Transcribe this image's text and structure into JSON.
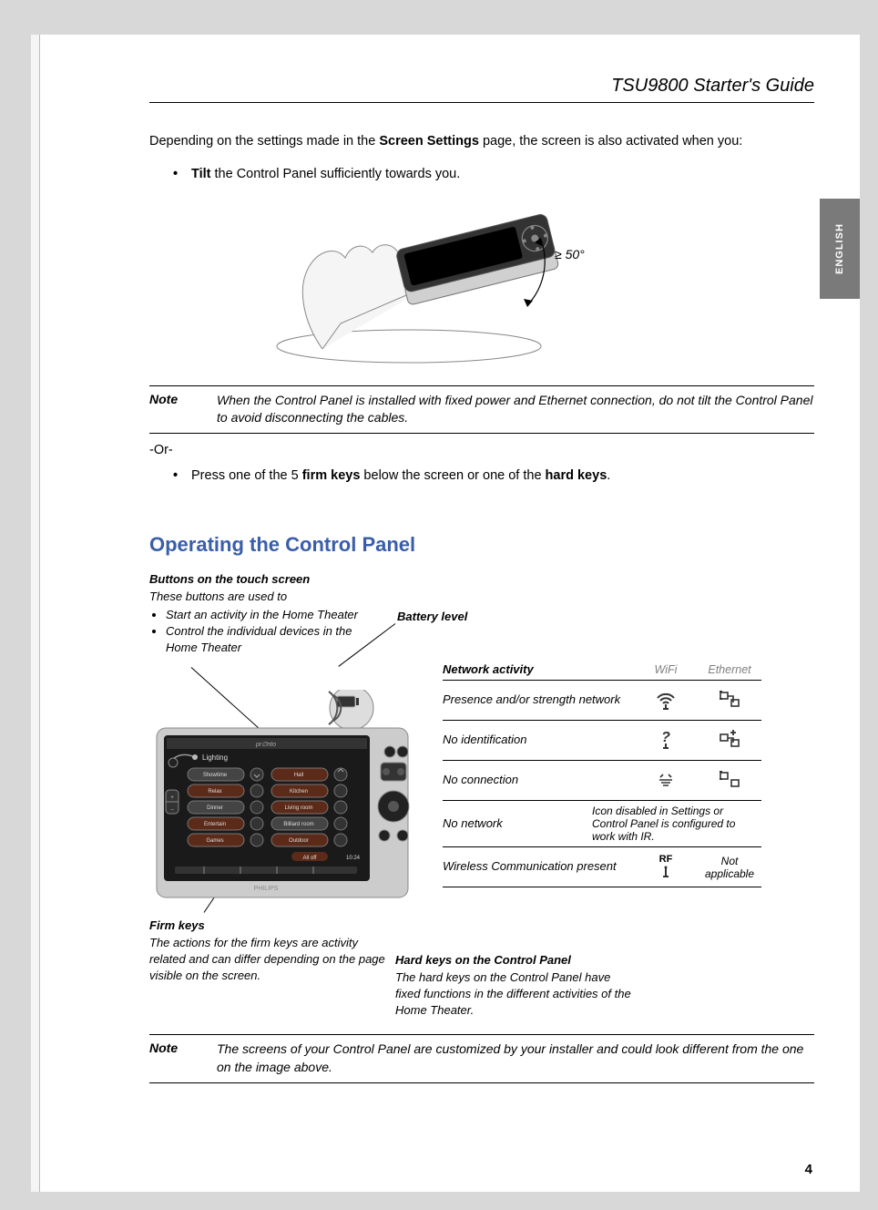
{
  "header": {
    "title": "TSU9800 Starter's Guide"
  },
  "language_tab": "ENGLISH",
  "intro": {
    "pre": "Depending on the settings made in the ",
    "bold": "Screen Settings",
    "post": " page, the screen is also activated when you:"
  },
  "bullet1": {
    "bold": "Tilt",
    "rest": " the Control Panel sufficiently towards you."
  },
  "tilt_threshold": "≥ 50°",
  "note1": {
    "label": "Note",
    "text": "When the Control Panel is installed with fixed power and Ethernet connection, do not tilt the Control Panel to avoid disconnecting the cables."
  },
  "or_text": "-Or-",
  "bullet2": {
    "pre": "Press one of the 5 ",
    "b1": "firm keys",
    "mid": " below the screen or one of the ",
    "b2": "hard keys",
    "post": "."
  },
  "section_heading": "Operating the Control Panel",
  "touch_buttons": {
    "title": "Buttons on the touch screen",
    "intro": "These buttons are used to",
    "items": [
      "Start an activity in the Home Theater",
      "Control the individual devices in the Home Theater"
    ]
  },
  "battery_label": "Battery level",
  "firm_keys": {
    "title": "Firm keys",
    "text": "The actions for the firm keys are activity related and can differ depending on the page visible on the screen."
  },
  "hard_keys": {
    "title": "Hard keys on the Control Panel",
    "text": "The hard keys on the Control Panel have fixed functions in the different activities of the Home Theater."
  },
  "network_table": {
    "header": {
      "label": "Network activity",
      "col1": "WiFi",
      "col2": "Ethernet"
    },
    "rows": [
      {
        "label": "Presence and/or strength network",
        "wifi_icon": "wifi-signal-icon",
        "eth_icon": "ethernet-icon"
      },
      {
        "label": "No identification",
        "wifi_icon": "wifi-question-icon",
        "eth_icon": "ethernet-plus-icon"
      },
      {
        "label": "No connection",
        "wifi_icon": "wifi-off-icon",
        "eth_icon": "ethernet-off-icon"
      },
      {
        "label": "No network",
        "note": "Icon disabled in Settings or Control Panel is configured to work with IR."
      },
      {
        "label": "Wireless Communication present",
        "wifi_text": "RF",
        "wifi_icon": "rf-antenna-icon",
        "eth_text": "Not applicable"
      }
    ]
  },
  "note2": {
    "label": "Note",
    "text": "The screens of your Control Panel are customized by your installer and could look different from the one on the image above."
  },
  "page_number": "4",
  "device": {
    "title": "Lighting",
    "rows": [
      [
        "Showtime",
        "Hall"
      ],
      [
        "Relax",
        "Kitchen"
      ],
      [
        "Dinner",
        "Living room"
      ],
      [
        "Entertain",
        "Billiard room"
      ],
      [
        "Games",
        "Outdoor"
      ]
    ]
  }
}
